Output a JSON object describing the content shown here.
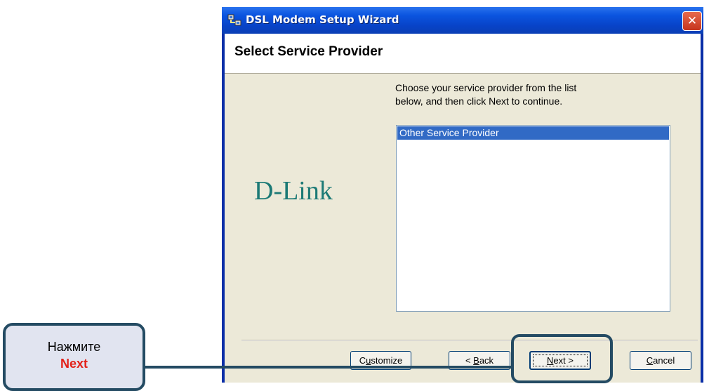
{
  "window": {
    "title": "DSL Modem Setup Wizard",
    "close_glyph": "✕"
  },
  "header": {
    "title": "Select Service Provider"
  },
  "logo": {
    "text": "D-Link"
  },
  "instruction": {
    "line1": "Choose your service provider from the list",
    "line2": "below, and then click Next to continue."
  },
  "provider_list": {
    "items": [
      "Other Service Provider"
    ],
    "selected": "Other Service Provider"
  },
  "buttons": {
    "customize_prefix": "C",
    "customize_mnemonic": "u",
    "customize_suffix": "stomize",
    "back_prefix": "< ",
    "back_mnemonic": "B",
    "back_suffix": "ack",
    "next_mnemonic": "N",
    "next_suffix": "ext >",
    "cancel_mnemonic": "C",
    "cancel_suffix": "ancel"
  },
  "callout": {
    "line1": "Нажмите",
    "line2": "Next",
    "line2_color": "#e32119",
    "frame_color": "#244b63"
  },
  "colors": {
    "titlebar": "#0b55e0",
    "selection": "#316ac5",
    "logo": "#1c7a76"
  }
}
